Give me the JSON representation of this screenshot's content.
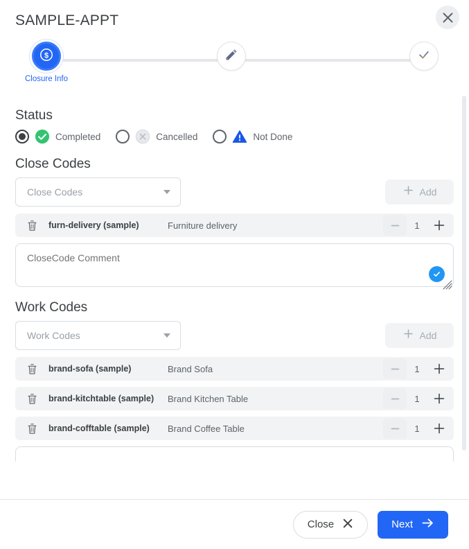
{
  "header": {
    "title": "SAMPLE-APPT",
    "close_icon": "close-icon"
  },
  "stepper": {
    "steps": [
      {
        "label": "Closure Info",
        "icon": "dollar-coin-icon",
        "state": "active"
      },
      {
        "label": "",
        "icon": "pencil-icon",
        "state": "inactive"
      },
      {
        "label": "",
        "icon": "check-icon",
        "state": "inactive"
      }
    ]
  },
  "status": {
    "heading": "Status",
    "options": [
      {
        "label": "Completed",
        "icon": "check-circle-green-icon",
        "selected": true
      },
      {
        "label": "Cancelled",
        "icon": "cancel-circle-gray-icon",
        "selected": false
      },
      {
        "label": "Not Done",
        "icon": "warning-triangle-blue-icon",
        "selected": false
      }
    ]
  },
  "close_codes": {
    "heading": "Close Codes",
    "select_placeholder": "Close Codes",
    "add_label": "Add",
    "rows": [
      {
        "code": "furn-delivery (sample)",
        "description": "Furniture delivery",
        "qty": "1"
      }
    ],
    "comment_placeholder": "CloseCode Comment",
    "comment_value": ""
  },
  "work_codes": {
    "heading": "Work Codes",
    "select_placeholder": "Work Codes",
    "add_label": "Add",
    "rows": [
      {
        "code": "brand-sofa (sample)",
        "description": "Brand Sofa",
        "qty": "1"
      },
      {
        "code": "brand-kitchtable (sample)",
        "description": "Brand Kitchen Table",
        "qty": "1"
      },
      {
        "code": "brand-cofftable (sample)",
        "description": "Brand Coffee Table",
        "qty": "1"
      }
    ]
  },
  "footer": {
    "close_label": "Close",
    "next_label": "Next"
  },
  "colors": {
    "accent_blue": "#2266f5",
    "success_green": "#34c471",
    "cancelled_gray": "#dadce0",
    "warning_blue": "#1a56e8",
    "row_bg": "#f1f3f4",
    "text_primary": "#3c4043",
    "text_secondary": "#5f6368",
    "placeholder": "#9aa0a6"
  }
}
